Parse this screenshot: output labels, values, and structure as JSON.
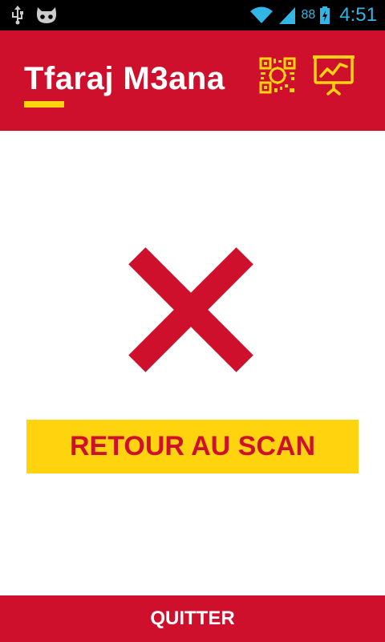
{
  "status_bar": {
    "battery_percent": "88",
    "time": "4:51",
    "icons": [
      "usb-icon",
      "cyanogen-mascot-icon",
      "wifi-icon",
      "signal-icon",
      "battery-charging-icon"
    ]
  },
  "app_bar": {
    "title": "Tfaraj M3ana",
    "icons": [
      "qr-scan-icon",
      "presentation-chart-icon"
    ]
  },
  "main": {
    "result_icon": "error-x-icon",
    "retour_label": "RETOUR AU SCAN"
  },
  "footer": {
    "quit_label": "QUITTER"
  },
  "colors": {
    "brand_red": "#cf102d",
    "accent_yellow": "#ffd40f",
    "status_blue": "#33b5e5"
  }
}
